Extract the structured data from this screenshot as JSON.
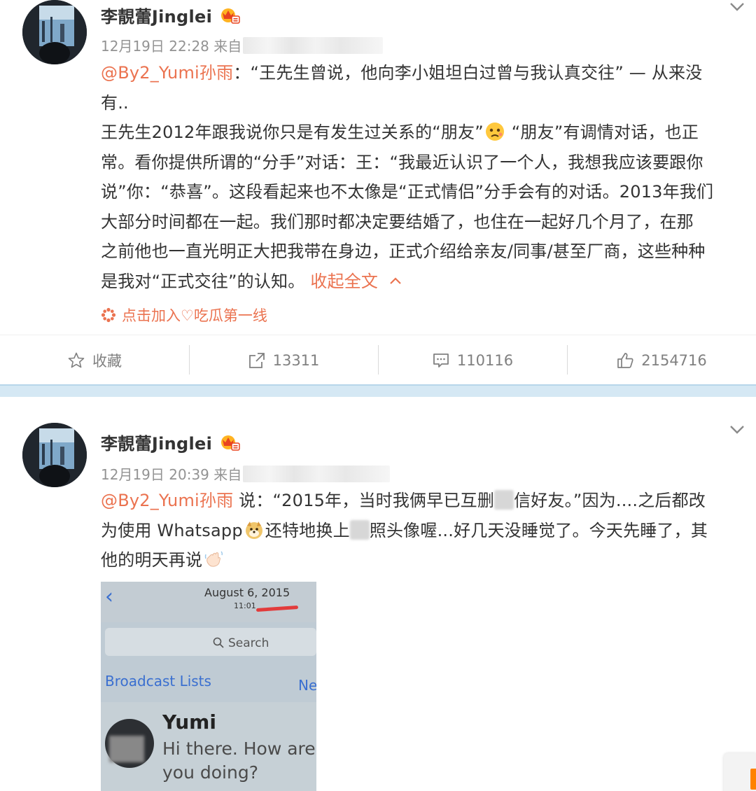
{
  "posts": [
    {
      "author": "李靚蕾Jinglei",
      "timestamp": "12月19日 22:28 来自",
      "mention": "@By2_Yumi孙雨",
      "body_line1_rest": "：“王先生曾说，他向李小姐坦白过曾与我认真交往” — 从来没",
      "body_line2": "有..",
      "body_line3a": "王先生2012年跟我说你只是有发生过关系的“朋友”",
      "body_line3b": " “朋友”有调情对话，也正",
      "body_line4": "常。看你提供所谓的“分手”对话：王：“我最近认识了一个人，我想我应该要跟你",
      "body_line5": "说”你：“恭喜”。这段看起来也不太像是“正式情侣”分手会有的对话。2013年我们",
      "body_line6": "大部分时间都在一起。我们那时都决定要结婚了，也住在一起好几个月了，在那",
      "body_line7": "之前他也一直光明正大把我带在身边，正式介绍给亲友/同事/甚至厂商，这些种种",
      "body_line8": "是我对“正式交往”的认知。",
      "collapse_label": "收起全文",
      "topic": "点击加入♡吃瓜第一线",
      "actions": {
        "favorite": "收藏",
        "repost": "13311",
        "comment": "110116",
        "like": "2154716"
      }
    },
    {
      "author": "李靚蕾Jinglei",
      "timestamp": "12月19日 20:39 来自",
      "mention": "@By2_Yumi孙雨",
      "line1a": " 说：“2015年，当时我俩早已互删",
      "line1b": "信好友。”因为....之后都改",
      "line2a": "为使用 Whatsapp",
      "line2b": "还特地换上",
      "line2c": "照头像喔...好几天没睡觉了。今天先睡了，其",
      "line3": "他的明天再说",
      "screenshot": {
        "date": "August 6, 2015",
        "time": "11:01",
        "search_placeholder": "Search",
        "broadcast": "Broadcast Lists",
        "new": "Ne",
        "contact": "Yumi",
        "message": "Hi there. How are you doing?"
      }
    }
  ],
  "colors": {
    "accent": "#eb7350",
    "meta": "#939393",
    "separator": "#d5e8f4"
  }
}
